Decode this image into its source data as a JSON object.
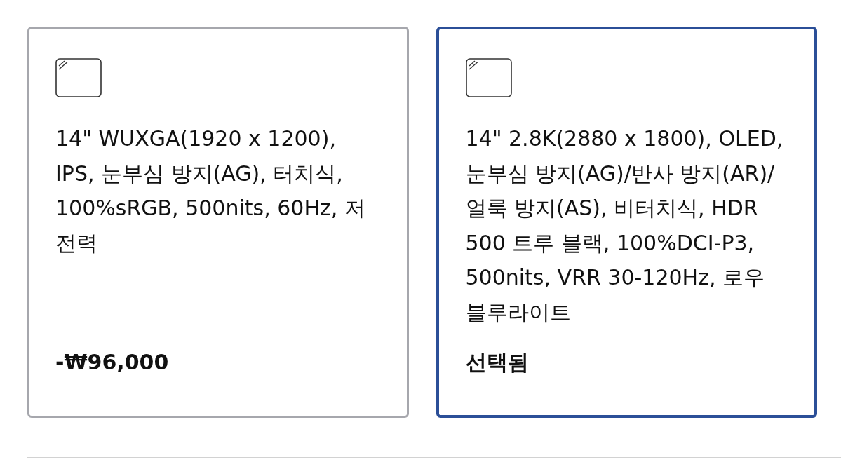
{
  "options": [
    {
      "description": "14\" WUXGA(1920 x 1200), IPS, 눈부심 방지(AG), 터치식, 100%sRGB, 500nits, 60Hz, 저전력",
      "price": "-₩96,000",
      "selected": false
    },
    {
      "description": "14\" 2.8K(2880 x 1800), OLED, 눈부심 방지(AG)/반사 방지(AR)/얼룩 방지(AS), 비터치식, HDR 500 트루 블랙, 100%DCI-P3, 500nits, VRR 30-120Hz, 로우 블루라이트",
      "status_label": "선택됨",
      "selected": true
    }
  ]
}
